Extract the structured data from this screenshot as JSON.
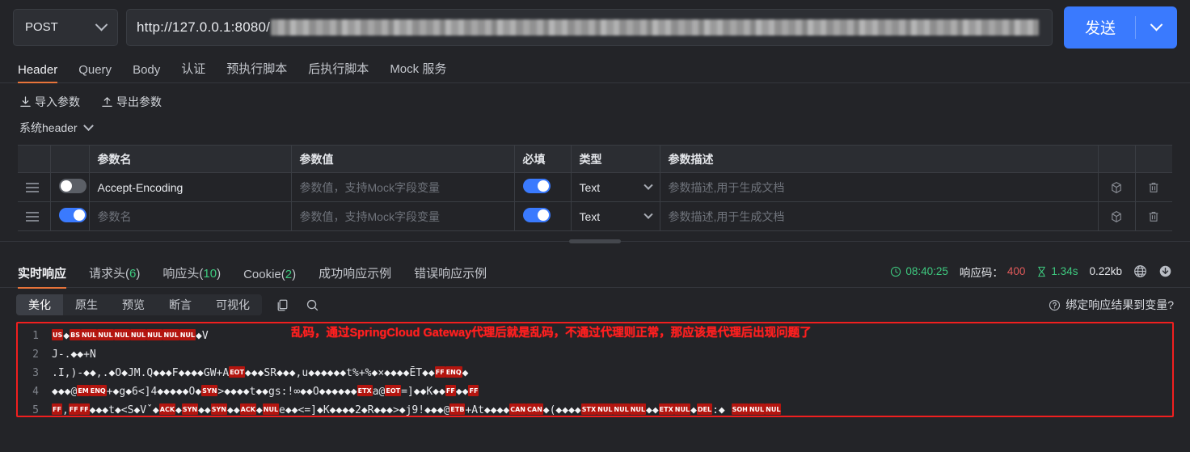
{
  "request": {
    "method": "POST",
    "method_icon": "chevron-down-icon",
    "url_prefix": "http://127.0.0.1:8080/",
    "url_redacted": true,
    "send_label": "发送",
    "send_caret_icon": "chevron-down-icon"
  },
  "tabs": [
    {
      "label": "Header",
      "active": true
    },
    {
      "label": "Query",
      "active": false
    },
    {
      "label": "Body",
      "active": false
    },
    {
      "label": "认证",
      "active": false
    },
    {
      "label": "预执行脚本",
      "active": false
    },
    {
      "label": "后执行脚本",
      "active": false
    },
    {
      "label": "Mock 服务",
      "active": false
    }
  ],
  "io_actions": [
    {
      "label": "导入参数",
      "icon": "import-icon"
    },
    {
      "label": "导出参数",
      "icon": "export-icon"
    }
  ],
  "section": {
    "label": "系统header",
    "chevron_icon": "chevron-down-icon"
  },
  "table": {
    "columns": [
      "",
      "",
      "参数名",
      "参数值",
      "必填",
      "类型",
      "参数描述",
      "",
      ""
    ],
    "rows": [
      {
        "drag_icon": "drag-handle-icon",
        "enabled": false,
        "name": "Accept-Encoding",
        "name_is_placeholder": false,
        "value": "参数值，支持Mock字段变量",
        "value_is_placeholder": true,
        "required": true,
        "type": "Text",
        "desc": "参数描述,用于生成文档",
        "desc_is_placeholder": true,
        "mock_icon": "cube-icon",
        "delete_icon": "trash-icon"
      },
      {
        "drag_icon": "drag-handle-icon",
        "enabled": true,
        "name": "参数名",
        "name_is_placeholder": true,
        "value": "参数值，支持Mock字段变量",
        "value_is_placeholder": true,
        "required": true,
        "type": "Text",
        "desc": "参数描述,用于生成文档",
        "desc_is_placeholder": true,
        "mock_icon": "cube-icon",
        "delete_icon": "trash-icon"
      }
    ]
  },
  "response": {
    "tabs": [
      {
        "label": "实时响应",
        "count": null,
        "active": true
      },
      {
        "label": "请求头",
        "count": "6",
        "active": false
      },
      {
        "label": "响应头",
        "count": "10",
        "active": false
      },
      {
        "label": "Cookie",
        "count": "2",
        "active": false
      },
      {
        "label": "成功响应示例",
        "count": null,
        "active": false
      },
      {
        "label": "错误响应示例",
        "count": null,
        "active": false
      }
    ],
    "meta": {
      "time_icon": "clock-icon",
      "time": "08:40:25",
      "status_label": "响应码：",
      "status_code": "400",
      "duration_icon": "hourglass-icon",
      "duration": "1.34s",
      "size": "0.22kb",
      "globe_icon": "globe-icon",
      "download_icon": "download-icon"
    },
    "toolbar": {
      "segments": [
        {
          "label": "美化",
          "active": true
        },
        {
          "label": "原生",
          "active": false
        },
        {
          "label": "预览",
          "active": false
        },
        {
          "label": "断言",
          "active": false
        },
        {
          "label": "可视化",
          "active": false
        }
      ],
      "copy_icon": "copy-icon",
      "search_icon": "search-icon",
      "bind_help_icon": "question-circle-icon",
      "bind_label": "绑定响应结果到变量?"
    },
    "annotation": "乱码，通过SpringCloud Gateway代理后就是乱码，不通过代理则正常，那应该是代理后出现问题了",
    "annotation_color": "#ff1f1f",
    "line_numbers": [
      "1",
      "2",
      "3",
      "4",
      "5"
    ],
    "code_lines": [
      [
        {
          "t": "ctl",
          "v": "US"
        },
        {
          "t": "r",
          "v": "◆"
        },
        {
          "t": "ctl",
          "v": "BS"
        },
        {
          "t": "ctl",
          "v": "NUL"
        },
        {
          "t": "ctl",
          "v": "NUL"
        },
        {
          "t": "ctl",
          "v": "NUL"
        },
        {
          "t": "ctl",
          "v": "NUL"
        },
        {
          "t": "ctl",
          "v": "NUL"
        },
        {
          "t": "ctl",
          "v": "NUL"
        },
        {
          "t": "ctl",
          "v": "NUL"
        },
        {
          "t": "r",
          "v": "◆"
        },
        {
          "t": "p",
          "v": "V"
        }
      ],
      [
        {
          "t": "p",
          "v": "J-.‌"
        },
        {
          "t": "r",
          "v": "◆◆"
        },
        {
          "t": "p",
          "v": "+N"
        }
      ],
      [
        {
          "t": "p",
          "v": ".I,)-"
        },
        {
          "t": "r",
          "v": "◆◆"
        },
        {
          "t": "p",
          "v": ",."
        },
        {
          "t": "r",
          "v": "◆"
        },
        {
          "t": "p",
          "v": "O"
        },
        {
          "t": "r",
          "v": "◆"
        },
        {
          "t": "p",
          "v": "JM.Q"
        },
        {
          "t": "r",
          "v": "◆◆◆"
        },
        {
          "t": "p",
          "v": "F"
        },
        {
          "t": "r",
          "v": "◆◆◆◆"
        },
        {
          "t": "p",
          "v": "GW+A"
        },
        {
          "t": "ctl",
          "v": "EOT"
        },
        {
          "t": "r",
          "v": "◆◆◆"
        },
        {
          "t": "p",
          "v": "SR"
        },
        {
          "t": "r",
          "v": "◆◆◆"
        },
        {
          "t": "p",
          "v": ",u"
        },
        {
          "t": "r",
          "v": "◆◆◆◆◆◆"
        },
        {
          "t": "p",
          "v": "t%+%"
        },
        {
          "t": "r",
          "v": "◆"
        },
        {
          "t": "p",
          "v": "×"
        },
        {
          "t": "r",
          "v": "◆◆◆◆"
        },
        {
          "t": "p",
          "v": "ĒT"
        },
        {
          "t": "r",
          "v": "◆◆"
        },
        {
          "t": "ctl",
          "v": "FF"
        },
        {
          "t": "ctl",
          "v": "ENQ"
        },
        {
          "t": "r",
          "v": "◆"
        }
      ],
      [
        {
          "t": "r",
          "v": "◆◆◆"
        },
        {
          "t": "p",
          "v": "@"
        },
        {
          "t": "ctl",
          "v": "EM"
        },
        {
          "t": "ctl",
          "v": "ENQ"
        },
        {
          "t": "p",
          "v": "+"
        },
        {
          "t": "r",
          "v": "◆"
        },
        {
          "t": "p",
          "v": "g"
        },
        {
          "t": "r",
          "v": "◆"
        },
        {
          "t": "p",
          "v": "6<]4"
        },
        {
          "t": "r",
          "v": "◆◆◆◆◆"
        },
        {
          "t": "p",
          "v": "O"
        },
        {
          "t": "r",
          "v": "◆"
        },
        {
          "t": "ctl",
          "v": "SYN"
        },
        {
          "t": "p",
          "v": ">"
        },
        {
          "t": "r",
          "v": "◆◆◆◆"
        },
        {
          "t": "p",
          "v": "t"
        },
        {
          "t": "r",
          "v": "◆◆"
        },
        {
          "t": "p",
          "v": "gs:!∞"
        },
        {
          "t": "r",
          "v": "◆◆"
        },
        {
          "t": "p",
          "v": "O"
        },
        {
          "t": "r",
          "v": "◆◆◆◆◆◆"
        },
        {
          "t": "ctl",
          "v": "ETX"
        },
        {
          "t": "p",
          "v": "a@"
        },
        {
          "t": "ctl",
          "v": "EOT"
        },
        {
          "t": "p",
          "v": "=]"
        },
        {
          "t": "r",
          "v": "◆◆"
        },
        {
          "t": "p",
          "v": "K"
        },
        {
          "t": "r",
          "v": "◆◆"
        },
        {
          "t": "ctl",
          "v": "FF"
        },
        {
          "t": "r",
          "v": "◆◆"
        },
        {
          "t": "ctl",
          "v": "FF"
        }
      ],
      [
        {
          "t": "ctl",
          "v": "FF"
        },
        {
          "t": "p",
          "v": ","
        },
        {
          "t": "ctl",
          "v": "FF"
        },
        {
          "t": "ctl",
          "v": "FF"
        },
        {
          "t": "r",
          "v": "◆◆◆"
        },
        {
          "t": "p",
          "v": "t"
        },
        {
          "t": "r",
          "v": "◆"
        },
        {
          "t": "p",
          "v": "<S"
        },
        {
          "t": "r",
          "v": "◆"
        },
        {
          "t": "p",
          "v": "Vˇ"
        },
        {
          "t": "r",
          "v": "◆"
        },
        {
          "t": "ctl",
          "v": "ACK"
        },
        {
          "t": "r",
          "v": "◆"
        },
        {
          "t": "ctl",
          "v": "SYN"
        },
        {
          "t": "r",
          "v": "◆◆"
        },
        {
          "t": "ctl",
          "v": "SYN"
        },
        {
          "t": "r",
          "v": "◆◆"
        },
        {
          "t": "ctl",
          "v": "ACK"
        },
        {
          "t": "r",
          "v": "◆"
        },
        {
          "t": "ctl",
          "v": "NUL"
        },
        {
          "t": "p",
          "v": "e"
        },
        {
          "t": "r",
          "v": "◆◆"
        },
        {
          "t": "p",
          "v": "<=]"
        },
        {
          "t": "r",
          "v": "◆"
        },
        {
          "t": "p",
          "v": "K"
        },
        {
          "t": "r",
          "v": "◆◆◆◆"
        },
        {
          "t": "p",
          "v": "2"
        },
        {
          "t": "r",
          "v": "◆"
        },
        {
          "t": "p",
          "v": "R"
        },
        {
          "t": "r",
          "v": "◆◆◆"
        },
        {
          "t": "p",
          "v": ">"
        },
        {
          "t": "r",
          "v": "◆"
        },
        {
          "t": "p",
          "v": "j9!"
        },
        {
          "t": "r",
          "v": "◆◆◆"
        },
        {
          "t": "p",
          "v": "@"
        },
        {
          "t": "ctl",
          "v": "ETB"
        },
        {
          "t": "p",
          "v": "+At"
        },
        {
          "t": "r",
          "v": "◆◆◆◆"
        },
        {
          "t": "ctl",
          "v": "CAN"
        },
        {
          "t": "ctl",
          "v": "CAN"
        },
        {
          "t": "r",
          "v": "◆"
        },
        {
          "t": "p",
          "v": "("
        },
        {
          "t": "r",
          "v": "◆◆◆◆"
        },
        {
          "t": "ctl",
          "v": "STX"
        },
        {
          "t": "ctl",
          "v": "NUL"
        },
        {
          "t": "ctl",
          "v": "NUL"
        },
        {
          "t": "ctl",
          "v": "NUL"
        },
        {
          "t": "r",
          "v": "◆◆"
        },
        {
          "t": "ctl",
          "v": "ETX"
        },
        {
          "t": "ctl",
          "v": "NUL"
        },
        {
          "t": "r",
          "v": "◆"
        },
        {
          "t": "ctl",
          "v": "DEL"
        },
        {
          "t": "p",
          "v": ":"
        },
        {
          "t": "r",
          "v": "◆"
        },
        {
          "t": "p",
          "v": "  "
        },
        {
          "t": "ctl",
          "v": "SOH"
        },
        {
          "t": "ctl",
          "v": "NUL"
        },
        {
          "t": "ctl",
          "v": "NUL"
        }
      ]
    ]
  },
  "colors": {
    "accent_orange": "#e8743a",
    "accent_blue": "#3a7afe",
    "success_green": "#3ec97f",
    "error_red": "#e05a5a",
    "annotation_red": "#ff1f1f",
    "bg": "#232428"
  }
}
